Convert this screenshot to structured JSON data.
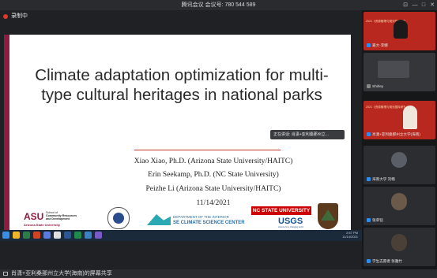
{
  "window": {
    "title": "腾讯会议 会议号: 780 544 589"
  },
  "recording": {
    "label": "录制中",
    "dot_color": "#e0392b"
  },
  "slide": {
    "title": "Climate adaptation optimization for multi-type cultural heritages in national parks",
    "authors": [
      "Xiao Xiao, Ph.D. (Arizona State University/HAITC)",
      "Erin Seekamp, Ph.D. (NC State University)",
      "Peizhe Li (Arizona State University/HAITC)"
    ],
    "date": "11/14/2021",
    "accent_color": "#8c1d40",
    "logos": {
      "asu": {
        "mark": "ASU",
        "line1": "School of",
        "line2": "Community Resources",
        "line3": "and Development",
        "line4": "Arizona State University"
      },
      "dept_interior": {
        "line1": "DEPARTMENT OF THE INTERIOR",
        "line2": "SE CLIMATE SCIENCE CENTER"
      },
      "ncstate": {
        "text": "NC STATE UNIVERSITY"
      },
      "usgs": {
        "text": "USGS",
        "tagline": "science for a changing world"
      }
    }
  },
  "share_tooltip": {
    "text": "正在讲话: 肖潇+亚利桑那州立..."
  },
  "taskbar": {
    "time": "2:57 PM",
    "date": "11/14/2021"
  },
  "status": {
    "text": "肖潇+亚利桑那州立大学(海南)的屏幕共享"
  },
  "participants": [
    {
      "name": "嘉大-李娜"
    },
    {
      "name": "Shirley"
    },
    {
      "name": "肖潇+亚利桑那州立大学(海南)"
    },
    {
      "name": "海南大学 刘畅"
    },
    {
      "name": "张荣铠"
    },
    {
      "name": "学生志愿者 张雅竹"
    }
  ],
  "banner_text": "2021《资源管理与规划国际研究年会"
}
